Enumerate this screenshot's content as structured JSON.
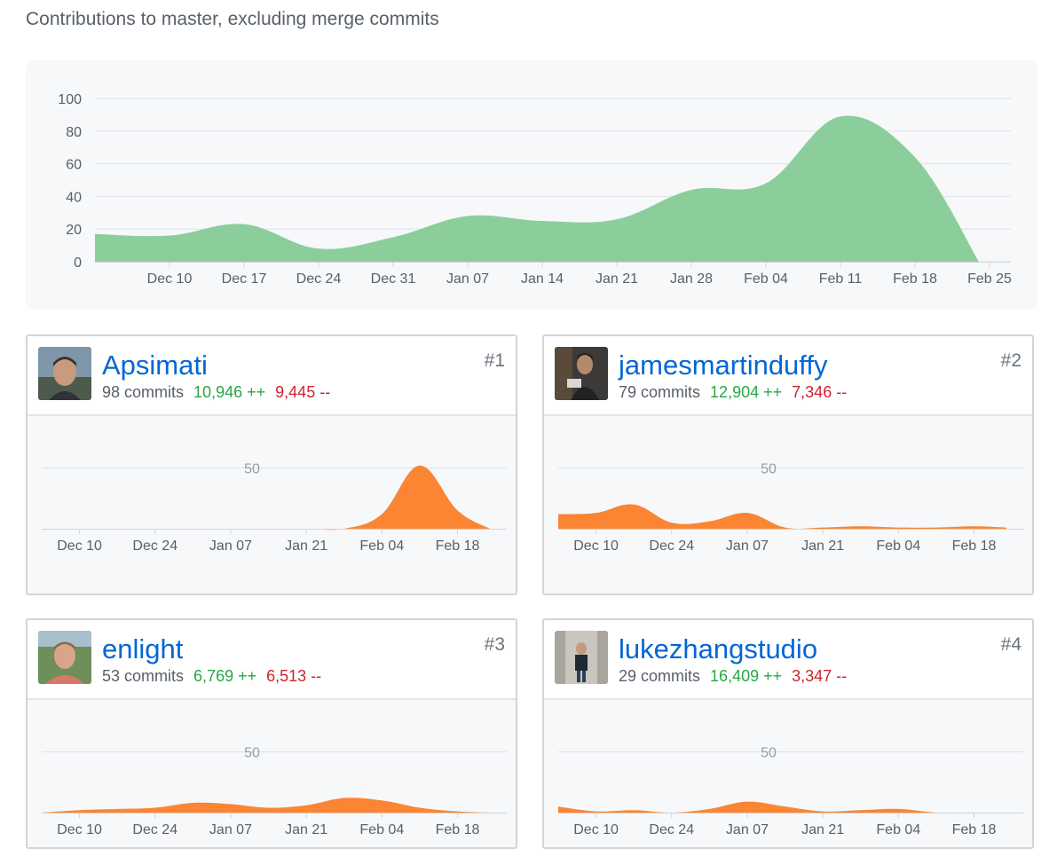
{
  "header": {
    "subtitle": "Contributions to master, excluding merge commits"
  },
  "colors": {
    "main_area": "#8cce9b",
    "contributor_area": "#fb8532",
    "link": "#0366d6",
    "additions": "#28a745",
    "deletions": "#cb2431"
  },
  "chart_data": [
    {
      "type": "area",
      "title": "Contributions to master, excluding merge commits",
      "x_ticks": [
        "Dec 10",
        "Dec 17",
        "Dec 24",
        "Dec 31",
        "Jan 07",
        "Jan 14",
        "Jan 21",
        "Jan 28",
        "Feb 04",
        "Feb 11",
        "Feb 18",
        "Feb 25"
      ],
      "y_ticks": [
        0,
        20,
        40,
        60,
        80,
        100
      ],
      "ylim": [
        0,
        100
      ],
      "grid": true,
      "series": [
        {
          "x": [
            "Dec 03",
            "Dec 10",
            "Dec 17",
            "Dec 24",
            "Dec 31",
            "Jan 07",
            "Jan 14",
            "Jan 21",
            "Jan 28",
            "Feb 04",
            "Feb 11",
            "Feb 18",
            "Feb 24"
          ],
          "values": [
            17,
            16,
            23,
            8,
            15,
            28,
            25,
            26,
            44,
            48,
            89,
            64,
            0
          ]
        }
      ]
    },
    {
      "type": "area",
      "x_ticks": [
        "Dec 10",
        "Dec 24",
        "Jan 07",
        "Jan 21",
        "Feb 04",
        "Feb 18"
      ],
      "y_ticks": [
        50
      ],
      "ylim": [
        0,
        62
      ],
      "series": [
        {
          "x": [
            "Dec 03",
            "Dec 10",
            "Dec 17",
            "Dec 24",
            "Dec 31",
            "Jan 07",
            "Jan 14",
            "Jan 21",
            "Jan 28",
            "Feb 04",
            "Feb 11",
            "Feb 18",
            "Feb 24"
          ],
          "values": [
            0,
            0,
            0,
            0,
            0,
            0,
            0,
            0,
            0,
            12,
            52,
            15,
            0
          ]
        }
      ]
    },
    {
      "type": "area",
      "x_ticks": [
        "Dec 10",
        "Dec 24",
        "Jan 07",
        "Jan 21",
        "Feb 04",
        "Feb 18"
      ],
      "y_ticks": [
        50
      ],
      "ylim": [
        0,
        62
      ],
      "series": [
        {
          "x": [
            "Dec 03",
            "Dec 10",
            "Dec 17",
            "Dec 24",
            "Dec 31",
            "Jan 07",
            "Jan 14",
            "Jan 21",
            "Jan 28",
            "Feb 04",
            "Feb 11",
            "Feb 18",
            "Feb 24"
          ],
          "values": [
            12,
            13,
            20,
            5,
            6,
            13,
            1,
            1,
            2,
            1,
            1,
            2,
            1
          ]
        }
      ]
    },
    {
      "type": "area",
      "x_ticks": [
        "Dec 10",
        "Dec 24",
        "Jan 07",
        "Jan 21",
        "Feb 04",
        "Feb 18"
      ],
      "y_ticks": [
        50
      ],
      "ylim": [
        0,
        62
      ],
      "series": [
        {
          "x": [
            "Dec 03",
            "Dec 10",
            "Dec 17",
            "Dec 24",
            "Dec 31",
            "Jan 07",
            "Jan 14",
            "Jan 21",
            "Jan 28",
            "Feb 04",
            "Feb 11",
            "Feb 18",
            "Feb 24"
          ],
          "values": [
            0,
            2,
            3,
            4,
            8,
            7,
            4,
            6,
            12,
            10,
            4,
            1,
            0
          ]
        }
      ]
    },
    {
      "type": "area",
      "x_ticks": [
        "Dec 10",
        "Dec 24",
        "Jan 07",
        "Jan 21",
        "Feb 04",
        "Feb 18"
      ],
      "y_ticks": [
        50
      ],
      "ylim": [
        0,
        62
      ],
      "series": [
        {
          "x": [
            "Dec 03",
            "Dec 10",
            "Dec 17",
            "Dec 24",
            "Dec 31",
            "Jan 07",
            "Jan 14",
            "Jan 21",
            "Jan 28",
            "Feb 04",
            "Feb 11",
            "Feb 18",
            "Feb 24"
          ],
          "values": [
            5,
            1,
            2,
            0,
            3,
            9,
            5,
            1,
            2,
            3,
            0,
            0,
            0
          ]
        }
      ]
    }
  ],
  "contributors": [
    {
      "name": "Apsimati",
      "commits": "98 commits",
      "additions": "10,946 ++",
      "deletions": "9,445 --",
      "rank": "#1"
    },
    {
      "name": "jamesmartinduffy",
      "commits": "79 commits",
      "additions": "12,904 ++",
      "deletions": "7,346 --",
      "rank": "#2"
    },
    {
      "name": "enlight",
      "commits": "53 commits",
      "additions": "6,769 ++",
      "deletions": "6,513 --",
      "rank": "#3"
    },
    {
      "name": "lukezhangstudio",
      "commits": "29 commits",
      "additions": "16,409 ++",
      "deletions": "3,347 --",
      "rank": "#4"
    }
  ]
}
